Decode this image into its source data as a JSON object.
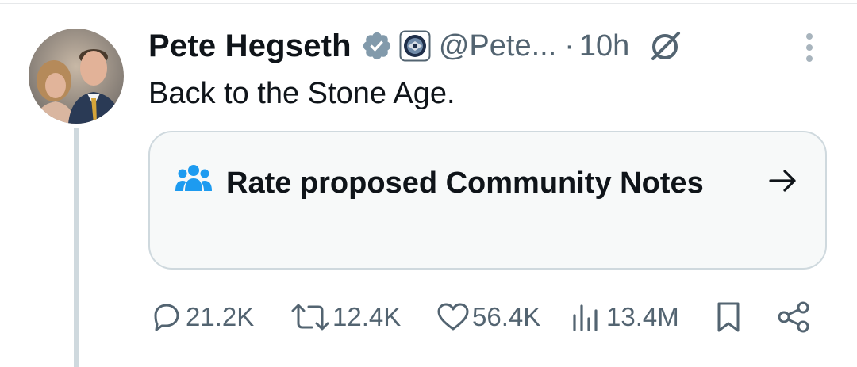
{
  "tweet": {
    "author": {
      "display_name": "Pete Hegseth",
      "handle": "@Pete...",
      "avatar": "profile-photo"
    },
    "separator": "·",
    "time": "10h",
    "text": "Back to the Stone Age.",
    "community_notes": {
      "label": "Rate proposed Community Notes",
      "icon": "people-icon"
    },
    "actions": {
      "replies": "21.2K",
      "reposts": "12.4K",
      "likes": "56.4K",
      "views": "13.4M"
    }
  },
  "colors": {
    "text_primary": "#0f1419",
    "text_secondary": "#536471",
    "accent_blue": "#1d9bf0",
    "verified_badge": "#829aab",
    "card_border": "#cfd9de",
    "card_bg": "#f7f9f9"
  }
}
